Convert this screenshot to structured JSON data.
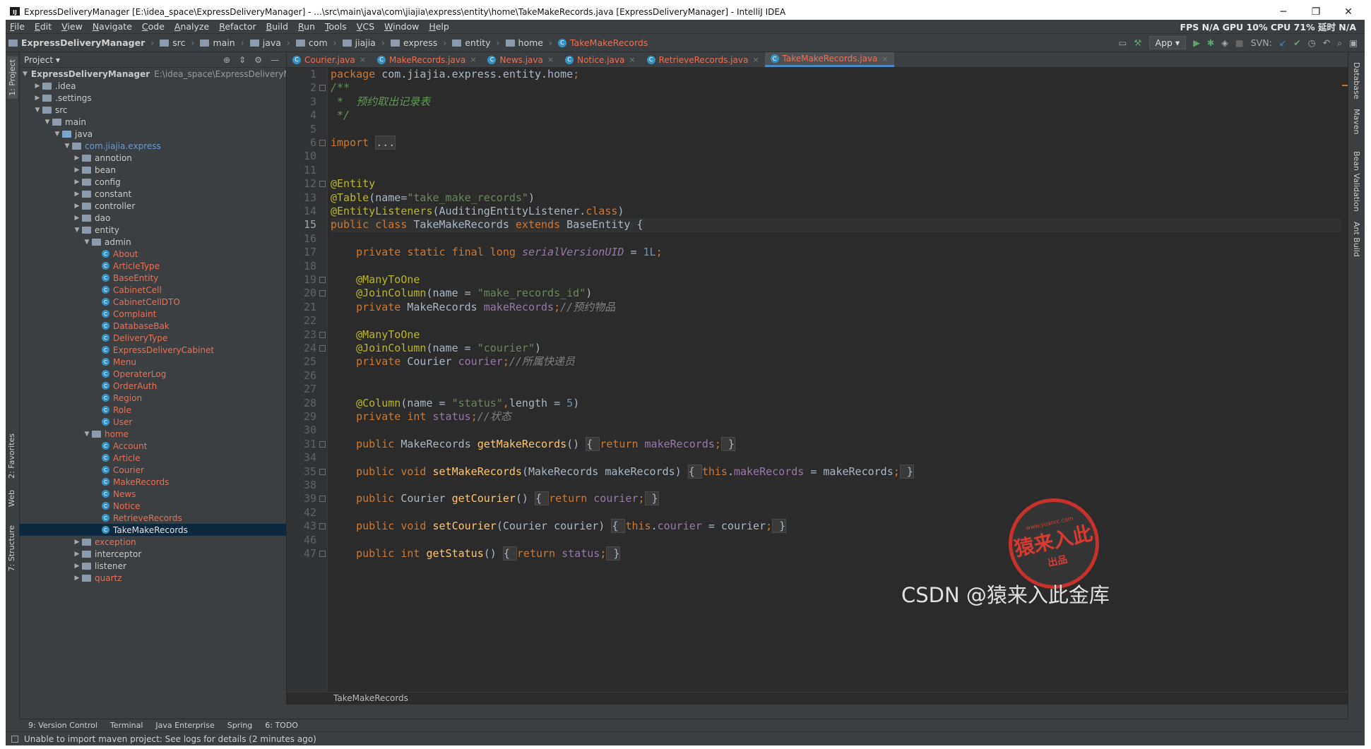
{
  "window": {
    "title": "ExpressDeliveryManager [E:\\idea_space\\ExpressDeliveryManager] - ...\\src\\main\\java\\com\\jiajia\\express\\entity\\home\\TakeMakeRecords.java [ExpressDeliveryManager] - IntelliJ IDEA",
    "minimize": "─",
    "restore": "❐",
    "close": "✕"
  },
  "menu": [
    "File",
    "Edit",
    "View",
    "Navigate",
    "Code",
    "Analyze",
    "Refactor",
    "Build",
    "Run",
    "Tools",
    "VCS",
    "Window",
    "Help"
  ],
  "perf": "FPS N/A GPU 10% CPU 71% 延时 N/A",
  "breadcrumb": [
    "ExpressDeliveryManager",
    "src",
    "main",
    "java",
    "com",
    "jiajia",
    "express",
    "entity",
    "home",
    "TakeMakeRecords"
  ],
  "toolbar": {
    "run_config": "App ▾",
    "svn": "SVN:"
  },
  "project": {
    "header": "Project ▾"
  },
  "tree": [
    {
      "label": "ExpressDeliveryManager",
      "extra": "E:\\idea_space\\ExpressDeliveryManager",
      "depth": 0,
      "arrow": "▼",
      "icon": "folder"
    },
    {
      "label": ".idea",
      "depth": 1,
      "arrow": "▶",
      "icon": "folder"
    },
    {
      "label": ".settings",
      "depth": 1,
      "arrow": "▶",
      "icon": "folder"
    },
    {
      "label": "src",
      "depth": 1,
      "arrow": "▼",
      "icon": "folder"
    },
    {
      "label": "main",
      "depth": 2,
      "arrow": "▼",
      "icon": "folder"
    },
    {
      "label": "java",
      "depth": 3,
      "arrow": "▼",
      "icon": "folder-blue"
    },
    {
      "label": "com.jiajia.express",
      "depth": 4,
      "arrow": "▼",
      "icon": "folder",
      "style": "pkg"
    },
    {
      "label": "annotion",
      "depth": 5,
      "arrow": "▶",
      "icon": "folder"
    },
    {
      "label": "bean",
      "depth": 5,
      "arrow": "▶",
      "icon": "folder"
    },
    {
      "label": "config",
      "depth": 5,
      "arrow": "▶",
      "icon": "folder"
    },
    {
      "label": "constant",
      "depth": 5,
      "arrow": "▶",
      "icon": "folder"
    },
    {
      "label": "controller",
      "depth": 5,
      "arrow": "▶",
      "icon": "folder"
    },
    {
      "label": "dao",
      "depth": 5,
      "arrow": "▶",
      "icon": "folder"
    },
    {
      "label": "entity",
      "depth": 5,
      "arrow": "▼",
      "icon": "folder"
    },
    {
      "label": "admin",
      "depth": 6,
      "arrow": "▼",
      "icon": "folder"
    },
    {
      "label": "About",
      "depth": 7,
      "icon": "class",
      "style": "red"
    },
    {
      "label": "ArticleType",
      "depth": 7,
      "icon": "class",
      "style": "red"
    },
    {
      "label": "BaseEntity",
      "depth": 7,
      "icon": "class",
      "style": "red"
    },
    {
      "label": "CabinetCell",
      "depth": 7,
      "icon": "class",
      "style": "red"
    },
    {
      "label": "CabinetCellDTO",
      "depth": 7,
      "icon": "class",
      "style": "red"
    },
    {
      "label": "Complaint",
      "depth": 7,
      "icon": "class",
      "style": "red"
    },
    {
      "label": "DatabaseBak",
      "depth": 7,
      "icon": "class",
      "style": "red"
    },
    {
      "label": "DeliveryType",
      "depth": 7,
      "icon": "class",
      "style": "red"
    },
    {
      "label": "ExpressDeliveryCabinet",
      "depth": 7,
      "icon": "class",
      "style": "red"
    },
    {
      "label": "Menu",
      "depth": 7,
      "icon": "class",
      "style": "red"
    },
    {
      "label": "OperaterLog",
      "depth": 7,
      "icon": "class",
      "style": "red"
    },
    {
      "label": "OrderAuth",
      "depth": 7,
      "icon": "class",
      "style": "red"
    },
    {
      "label": "Region",
      "depth": 7,
      "icon": "class",
      "style": "red"
    },
    {
      "label": "Role",
      "depth": 7,
      "icon": "class",
      "style": "red"
    },
    {
      "label": "User",
      "depth": 7,
      "icon": "class",
      "style": "red"
    },
    {
      "label": "home",
      "depth": 6,
      "arrow": "▼",
      "icon": "folder",
      "style": "red"
    },
    {
      "label": "Account",
      "depth": 7,
      "icon": "class",
      "style": "red"
    },
    {
      "label": "Article",
      "depth": 7,
      "icon": "class",
      "style": "red"
    },
    {
      "label": "Courier",
      "depth": 7,
      "icon": "class",
      "style": "red"
    },
    {
      "label": "MakeRecords",
      "depth": 7,
      "icon": "class",
      "style": "red"
    },
    {
      "label": "News",
      "depth": 7,
      "icon": "class",
      "style": "red"
    },
    {
      "label": "Notice",
      "depth": 7,
      "icon": "class",
      "style": "red"
    },
    {
      "label": "RetrieveRecords",
      "depth": 7,
      "icon": "class",
      "style": "red"
    },
    {
      "label": "TakeMakeRecords",
      "depth": 7,
      "icon": "class",
      "style": "red",
      "selected": true
    },
    {
      "label": "exception",
      "depth": 5,
      "arrow": "▶",
      "icon": "folder",
      "style": "red"
    },
    {
      "label": "interceptor",
      "depth": 5,
      "arrow": "▶",
      "icon": "folder"
    },
    {
      "label": "listener",
      "depth": 5,
      "arrow": "▶",
      "icon": "folder"
    },
    {
      "label": "quartz",
      "depth": 5,
      "arrow": "▶",
      "icon": "folder",
      "style": "red"
    }
  ],
  "tabs": [
    {
      "label": "Courier.java"
    },
    {
      "label": "MakeRecords.java"
    },
    {
      "label": "News.java"
    },
    {
      "label": "Notice.java"
    },
    {
      "label": "RetrieveRecords.java"
    },
    {
      "label": "TakeMakeRecords.java",
      "active": true
    }
  ],
  "code": [
    {
      "n": 1,
      "t": [
        [
          "k",
          "package "
        ],
        [
          "",
          "com.jiajia.express.entity.home"
        ],
        [
          "k",
          ";"
        ]
      ]
    },
    {
      "n": 2,
      "t": [
        [
          "cd",
          "/**"
        ]
      ],
      "fold": true
    },
    {
      "n": 3,
      "t": [
        [
          "cd",
          " *  预约取出记录表"
        ]
      ]
    },
    {
      "n": 4,
      "t": [
        [
          "cd",
          " */"
        ]
      ]
    },
    {
      "n": 5,
      "t": []
    },
    {
      "n": 6,
      "t": [
        [
          "k",
          "import "
        ],
        [
          "fd",
          "..."
        ]
      ],
      "fold": true
    },
    {
      "n": 10,
      "t": []
    },
    {
      "n": 11,
      "t": []
    },
    {
      "n": 12,
      "t": [
        [
          "a",
          "@Entity"
        ]
      ],
      "fold": true
    },
    {
      "n": 13,
      "t": [
        [
          "a",
          "@Table"
        ],
        [
          "",
          "("
        ],
        [
          "",
          "name="
        ],
        [
          "s",
          "\"take_make_records\""
        ],
        [
          "",
          ")"
        ]
      ]
    },
    {
      "n": 14,
      "t": [
        [
          "a",
          "@EntityListeners"
        ],
        [
          "",
          "(AuditingEntityListener."
        ],
        [
          "k",
          "class"
        ],
        [
          "",
          ")"
        ]
      ]
    },
    {
      "n": 15,
      "t": [
        [
          "k",
          "public class "
        ],
        [
          "",
          "TakeMakeRecords "
        ],
        [
          "k",
          "extends "
        ],
        [
          "",
          "BaseEntity {"
        ]
      ],
      "cur": true
    },
    {
      "n": 16,
      "t": []
    },
    {
      "n": 17,
      "t": [
        [
          "",
          "    "
        ],
        [
          "k",
          "private static final long "
        ],
        [
          "fi",
          "serialVersionUID"
        ],
        [
          "",
          " = "
        ],
        [
          "n",
          "1L"
        ],
        [
          "k",
          ";"
        ]
      ]
    },
    {
      "n": 18,
      "t": []
    },
    {
      "n": 19,
      "t": [
        [
          "",
          "    "
        ],
        [
          "a",
          "@ManyToOne"
        ]
      ],
      "fold": true
    },
    {
      "n": 20,
      "t": [
        [
          "",
          "    "
        ],
        [
          "a",
          "@JoinColumn"
        ],
        [
          "",
          "(name = "
        ],
        [
          "s",
          "\"make_records_id\""
        ],
        [
          "",
          ")"
        ]
      ],
      "fold": true
    },
    {
      "n": 21,
      "t": [
        [
          "",
          "    "
        ],
        [
          "k",
          "private "
        ],
        [
          "",
          "MakeRecords "
        ],
        [
          "f",
          "makeRecords"
        ],
        [
          "k",
          ";"
        ],
        [
          "c",
          "//预约物品"
        ]
      ]
    },
    {
      "n": 22,
      "t": []
    },
    {
      "n": 23,
      "t": [
        [
          "",
          "    "
        ],
        [
          "a",
          "@ManyToOne"
        ]
      ],
      "fold": true
    },
    {
      "n": 24,
      "t": [
        [
          "",
          "    "
        ],
        [
          "a",
          "@JoinColumn"
        ],
        [
          "",
          "(name = "
        ],
        [
          "s",
          "\"courier\""
        ],
        [
          "",
          ")"
        ]
      ],
      "fold": true
    },
    {
      "n": 25,
      "t": [
        [
          "",
          "    "
        ],
        [
          "k",
          "private "
        ],
        [
          "",
          "Courier "
        ],
        [
          "f",
          "courier"
        ],
        [
          "k",
          ";"
        ],
        [
          "c",
          "//所属快递员"
        ]
      ]
    },
    {
      "n": 26,
      "t": []
    },
    {
      "n": 27,
      "t": []
    },
    {
      "n": 28,
      "t": [
        [
          "",
          "    "
        ],
        [
          "a",
          "@Column"
        ],
        [
          "",
          "(name = "
        ],
        [
          "s",
          "\"status\""
        ],
        [
          "k",
          ","
        ],
        [
          "",
          "length = "
        ],
        [
          "n",
          "5"
        ],
        [
          "",
          ")"
        ]
      ]
    },
    {
      "n": 29,
      "t": [
        [
          "",
          "    "
        ],
        [
          "k",
          "private int "
        ],
        [
          "f",
          "status"
        ],
        [
          "k",
          ";"
        ],
        [
          "c",
          "//状态"
        ]
      ]
    },
    {
      "n": 30,
      "t": []
    },
    {
      "n": 31,
      "t": [
        [
          "",
          "    "
        ],
        [
          "k",
          "public "
        ],
        [
          "",
          "MakeRecords "
        ],
        [
          "m",
          "getMakeRecords"
        ],
        [
          "",
          "() "
        ],
        [
          "fd",
          "{ "
        ],
        [
          "k",
          "return "
        ],
        [
          "f",
          "makeRecords"
        ],
        [
          "k",
          ";"
        ],
        [
          "fd",
          " }"
        ]
      ],
      "fold": true
    },
    {
      "n": 34,
      "t": []
    },
    {
      "n": 35,
      "t": [
        [
          "",
          "    "
        ],
        [
          "k",
          "public void "
        ],
        [
          "m",
          "setMakeRecords"
        ],
        [
          "",
          "(MakeRecords makeRecords) "
        ],
        [
          "fd",
          "{ "
        ],
        [
          "k",
          "this"
        ],
        [
          "",
          "."
        ],
        [
          "f",
          "makeRecords"
        ],
        [
          "",
          " = makeRecords"
        ],
        [
          "k",
          ";"
        ],
        [
          "fd",
          " }"
        ]
      ],
      "fold": true
    },
    {
      "n": 38,
      "t": []
    },
    {
      "n": 39,
      "t": [
        [
          "",
          "    "
        ],
        [
          "k",
          "public "
        ],
        [
          "",
          "Courier "
        ],
        [
          "m",
          "getCourier"
        ],
        [
          "",
          "() "
        ],
        [
          "fd",
          "{ "
        ],
        [
          "k",
          "return "
        ],
        [
          "f",
          "courier"
        ],
        [
          "k",
          ";"
        ],
        [
          "fd",
          " }"
        ]
      ],
      "fold": true
    },
    {
      "n": 42,
      "t": []
    },
    {
      "n": 43,
      "t": [
        [
          "",
          "    "
        ],
        [
          "k",
          "public void "
        ],
        [
          "m",
          "setCourier"
        ],
        [
          "",
          "(Courier courier) "
        ],
        [
          "fd",
          "{ "
        ],
        [
          "k",
          "this"
        ],
        [
          "",
          "."
        ],
        [
          "f",
          "courier"
        ],
        [
          "",
          " = courier"
        ],
        [
          "k",
          ";"
        ],
        [
          "fd",
          " }"
        ]
      ],
      "fold": true
    },
    {
      "n": 46,
      "t": []
    },
    {
      "n": 47,
      "t": [
        [
          "",
          "    "
        ],
        [
          "k",
          "public int "
        ],
        [
          "m",
          "getStatus"
        ],
        [
          "",
          "() "
        ],
        [
          "fd",
          "{ "
        ],
        [
          "k",
          "return "
        ],
        [
          "f",
          "status"
        ],
        [
          "k",
          ";"
        ],
        [
          "fd",
          " }"
        ]
      ],
      "fold": true
    }
  ],
  "editor_breadcrumb": "TakeMakeRecords",
  "left_strip": {
    "project": "1: Project",
    "favorites": "2: Favorites",
    "web": "Web",
    "structure": "7: Structure"
  },
  "right_strip": {
    "database": "Database",
    "maven": "Maven",
    "bean": "Bean Validation",
    "ant": "Ant Build"
  },
  "tool_windows": [
    "9: Version Control",
    "Terminal",
    "Java Enterprise",
    "Spring",
    "6: TODO"
  ],
  "status_text": "Unable to import maven project: See logs for details (2 minutes ago)",
  "stamp": {
    "url": "www.yuanrc.com",
    "big": "猿来入此",
    "small": "出品"
  },
  "watermark": "CSDN @猿来入此金库"
}
